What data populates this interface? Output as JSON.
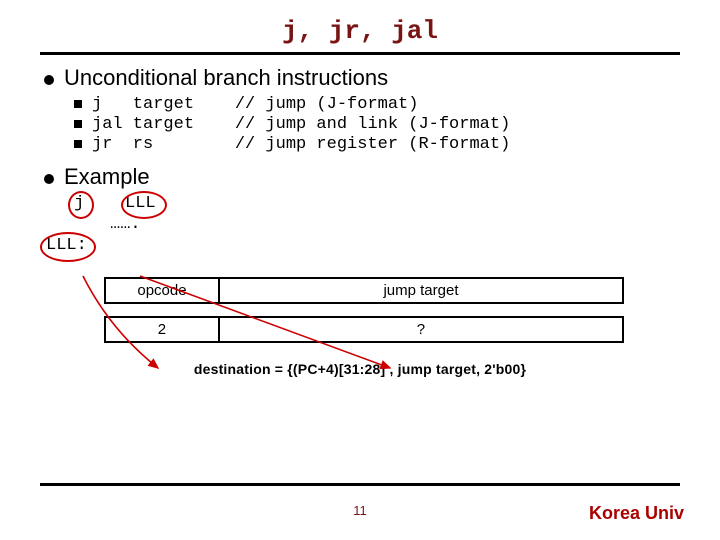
{
  "title": "j, jr, jal",
  "bullets": {
    "b1": "Unconditional branch instructions",
    "sub": {
      "r1": "j   target    // jump (J-format)",
      "r2": "jal target    // jump and link (J-format)",
      "r3": "jr  rs        // jump register (R-format)"
    },
    "b2": "Example",
    "ex_j": "j",
    "ex_lll": "LLL",
    "ex_dots": "…….",
    "ex_label": "LLL:"
  },
  "table": {
    "h_op": "opcode",
    "h_tg": "jump target",
    "v_op": "2",
    "v_tg": "?"
  },
  "dest": "destination = {(PC+4)[31:28] , jump target, 2'b00}",
  "page": "11",
  "footer": "Korea Univ"
}
